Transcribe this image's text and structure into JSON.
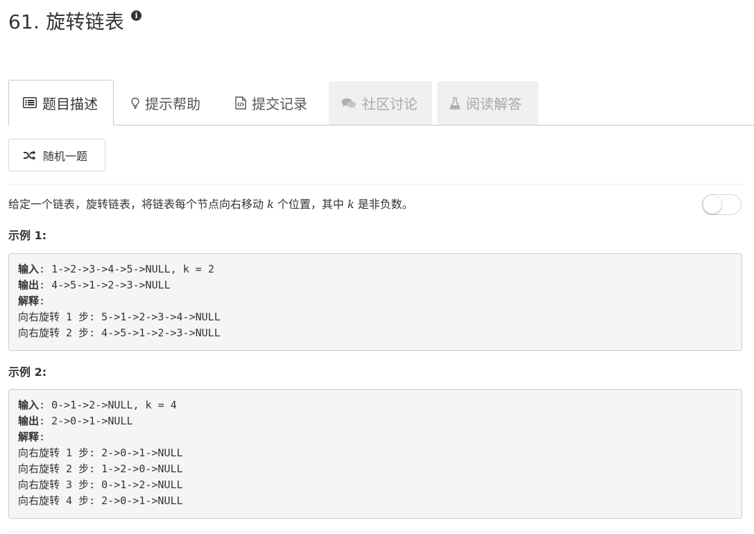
{
  "problem": {
    "title": "61. 旋转链表"
  },
  "tabs": [
    {
      "label": "题目描述",
      "icon": "list-icon",
      "state": "active"
    },
    {
      "label": "提示帮助",
      "icon": "lightbulb-icon",
      "state": "normal"
    },
    {
      "label": "提交记录",
      "icon": "code-file-icon",
      "state": "normal"
    },
    {
      "label": "社区讨论",
      "icon": "comments-icon",
      "state": "disabled"
    },
    {
      "label": "阅读解答",
      "icon": "flask-icon",
      "state": "disabled"
    }
  ],
  "random_button": {
    "label": "随机一题",
    "icon": "shuffle-icon"
  },
  "description": {
    "part1": "给定一个链表，旋转链表，将链表每个节点向右移动 ",
    "k1": "k",
    "part2": " 个位置，其中 ",
    "k2": "k",
    "part3": " 是非负数。"
  },
  "examples": [
    {
      "title": "示例 1:",
      "input_label": "输入",
      "input_value": ": 1->2->3->4->5->NULL, k = 2",
      "output_label": "输出",
      "output_value": ": 4->5->1->2->3->NULL",
      "explain_label": "解释",
      "explain_colon": ":",
      "steps": [
        "向右旋转 1 步: 5->1->2->3->4->NULL",
        "向右旋转 2 步: 4->5->1->2->3->NULL"
      ]
    },
    {
      "title": "示例 2:",
      "input_label": "输入",
      "input_value": ": 0->1->2->NULL, k = 4",
      "output_label": "输出",
      "output_value": ": 2->0->1->NULL",
      "explain_label": "解释",
      "explain_colon": ":",
      "steps": [
        "向右旋转 1 步: 2->0->1->NULL",
        "向右旋转 2 步: 1->2->0->NULL",
        "向右旋转 3 步: 0->1->2->NULL",
        "向右旋转 4 步: 2->0->1->NULL"
      ]
    }
  ],
  "colors": {
    "text": "#333333",
    "disabled_text": "#a8a8a8",
    "disabled_tab_bg": "#f0f0f0",
    "code_bg": "#f5f5f5",
    "border": "#c8c8c8"
  }
}
